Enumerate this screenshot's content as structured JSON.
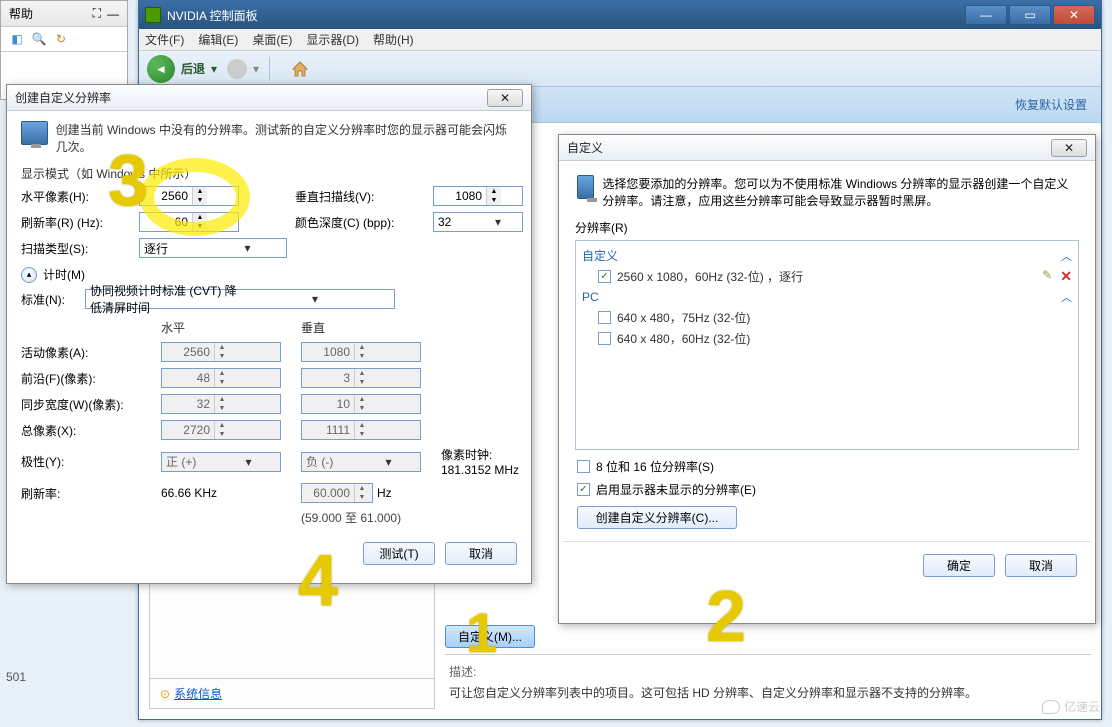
{
  "bg": {
    "help": "帮助",
    "num": "501"
  },
  "nvidia": {
    "title": "NVIDIA 控制面板",
    "menu": [
      "文件(F)",
      "编辑(E)",
      "桌面(E)",
      "显示器(D)",
      "帮助(H)"
    ],
    "back": "后退",
    "restore": "恢复默认设置",
    "custom_btn": "自定义(M)...",
    "desc_label": "描述:",
    "desc_text": "可让您自定义分辨率列表中的项目。这可包括 HD 分辨率、自定义分辨率和显示器不支持的分辨率。",
    "sys_info": "系统信息"
  },
  "create": {
    "title": "创建自定义分辨率",
    "intro": "创建当前 Windows 中没有的分辨率。测试新的自定义分辨率时您的显示器可能会闪烁几次。",
    "mode_label": "显示模式（如 Windows 中所示）",
    "h_pixels": "水平像素(H):",
    "h_val": "2560",
    "v_lines": "垂直扫描线(V):",
    "v_val": "1080",
    "refresh": "刷新率(R) (Hz):",
    "refresh_val": "60",
    "color": "颜色深度(C) (bpp):",
    "color_val": "32",
    "scan": "扫描类型(S):",
    "scan_val": "逐行",
    "timing": "计时(M)",
    "standard": "标准(N):",
    "standard_val": "协同视频计时标准 (CVT) 降低清屏时间",
    "col_h": "水平",
    "col_v": "垂直",
    "active": "活动像素(A):",
    "active_h": "2560",
    "active_v": "1080",
    "front": "前沿(F)(像素):",
    "front_h": "48",
    "front_v": "3",
    "sync": "同步宽度(W)(像素):",
    "sync_h": "32",
    "sync_v": "10",
    "total": "总像素(X):",
    "total_h": "2720",
    "total_v": "1111",
    "polarity": "极性(Y):",
    "pol_h": "正 (+)",
    "pol_v": "负 (-)",
    "refresh2": "刷新率:",
    "refresh_h": "66.66 KHz",
    "refresh_v": "60.000",
    "hz": "Hz",
    "range": "(59.000 至 61.000)",
    "pixel_clock_lbl": "像素时钟:",
    "pixel_clock": "181.3152 MHz",
    "test": "测试(T)",
    "cancel": "取消"
  },
  "custom": {
    "title": "自定义",
    "intro": "选择您要添加的分辨率。您可以为不使用标准 Windiows 分辨率的显示器创建一个自定义分辨率。请注意，应用这些分辨率可能会导致显示器暂时黑屏。",
    "res_label": "分辨率(R)",
    "grp_custom": "自定义",
    "item_custom": "2560 x 1080，60Hz (32-位) ，逐行",
    "grp_pc": "PC",
    "item_pc1": "640 x 480，75Hz (32-位)",
    "item_pc2": "640 x 480，60Hz (32-位)",
    "opt1": "8 位和 16 位分辨率(S)",
    "opt2": "启用显示器未显示的分辨率(E)",
    "create_btn": "创建自定义分辨率(C)...",
    "ok": "确定",
    "cancel": "取消"
  },
  "watermark": "亿速云"
}
